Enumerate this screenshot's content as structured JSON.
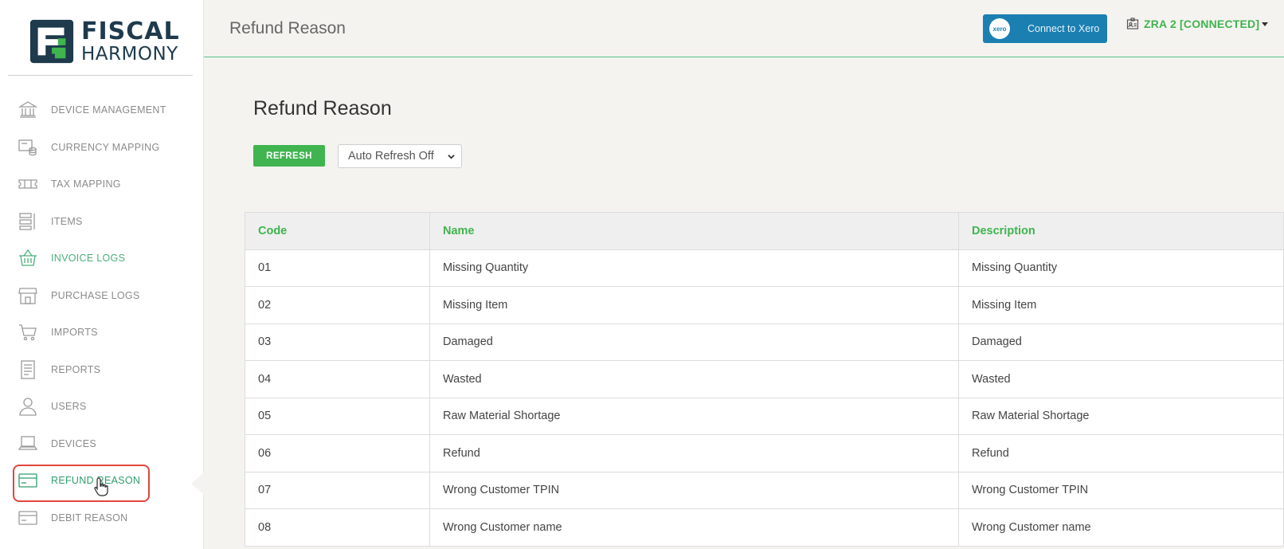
{
  "brand": {
    "word1": "FISCAL",
    "word2": "HARMONY",
    "colors": {
      "dark": "#1e3a4c",
      "green": "#3fb44f"
    }
  },
  "sidebar": {
    "items": [
      {
        "label": "DEVICE MANAGEMENT",
        "icon": "bank-icon"
      },
      {
        "label": "CURRENCY MAPPING",
        "icon": "currency-icon"
      },
      {
        "label": "TAX MAPPING",
        "icon": "ticket-icon"
      },
      {
        "label": "ITEMS",
        "icon": "list-icon"
      },
      {
        "label": "INVOICE LOGS",
        "icon": "basket-icon"
      },
      {
        "label": "PURCHASE LOGS",
        "icon": "store-icon"
      },
      {
        "label": "IMPORTS",
        "icon": "cart-icon"
      },
      {
        "label": "REPORTS",
        "icon": "report-icon"
      },
      {
        "label": "USERS",
        "icon": "user-icon"
      },
      {
        "label": "DEVICES",
        "icon": "laptop-icon"
      },
      {
        "label": "REFUND REASON",
        "icon": "card-icon"
      },
      {
        "label": "DEBIT REASON",
        "icon": "card-icon"
      }
    ],
    "active_index": 10
  },
  "header": {
    "title": "Refund Reason",
    "xero_button": "Connect to Xero",
    "xero_logo_text": "xero",
    "device_status": "ZRA 2 [CONNECTED]"
  },
  "main": {
    "heading": "Refund Reason",
    "refresh_label": "REFRESH",
    "auto_refresh": "Auto Refresh Off"
  },
  "table": {
    "columns": [
      "Code",
      "Name",
      "Description"
    ],
    "rows": [
      [
        "01",
        "Missing Quantity",
        "Missing Quantity"
      ],
      [
        "02",
        "Missing Item",
        "Missing Item"
      ],
      [
        "03",
        "Damaged",
        "Damaged"
      ],
      [
        "04",
        "Wasted",
        "Wasted"
      ],
      [
        "05",
        "Raw Material Shortage",
        "Raw Material Shortage"
      ],
      [
        "06",
        "Refund",
        "Refund"
      ],
      [
        "07",
        "Wrong Customer TPIN",
        "Wrong Customer TPIN"
      ],
      [
        "08",
        "Wrong Customer name",
        "Wrong Customer name"
      ]
    ]
  }
}
